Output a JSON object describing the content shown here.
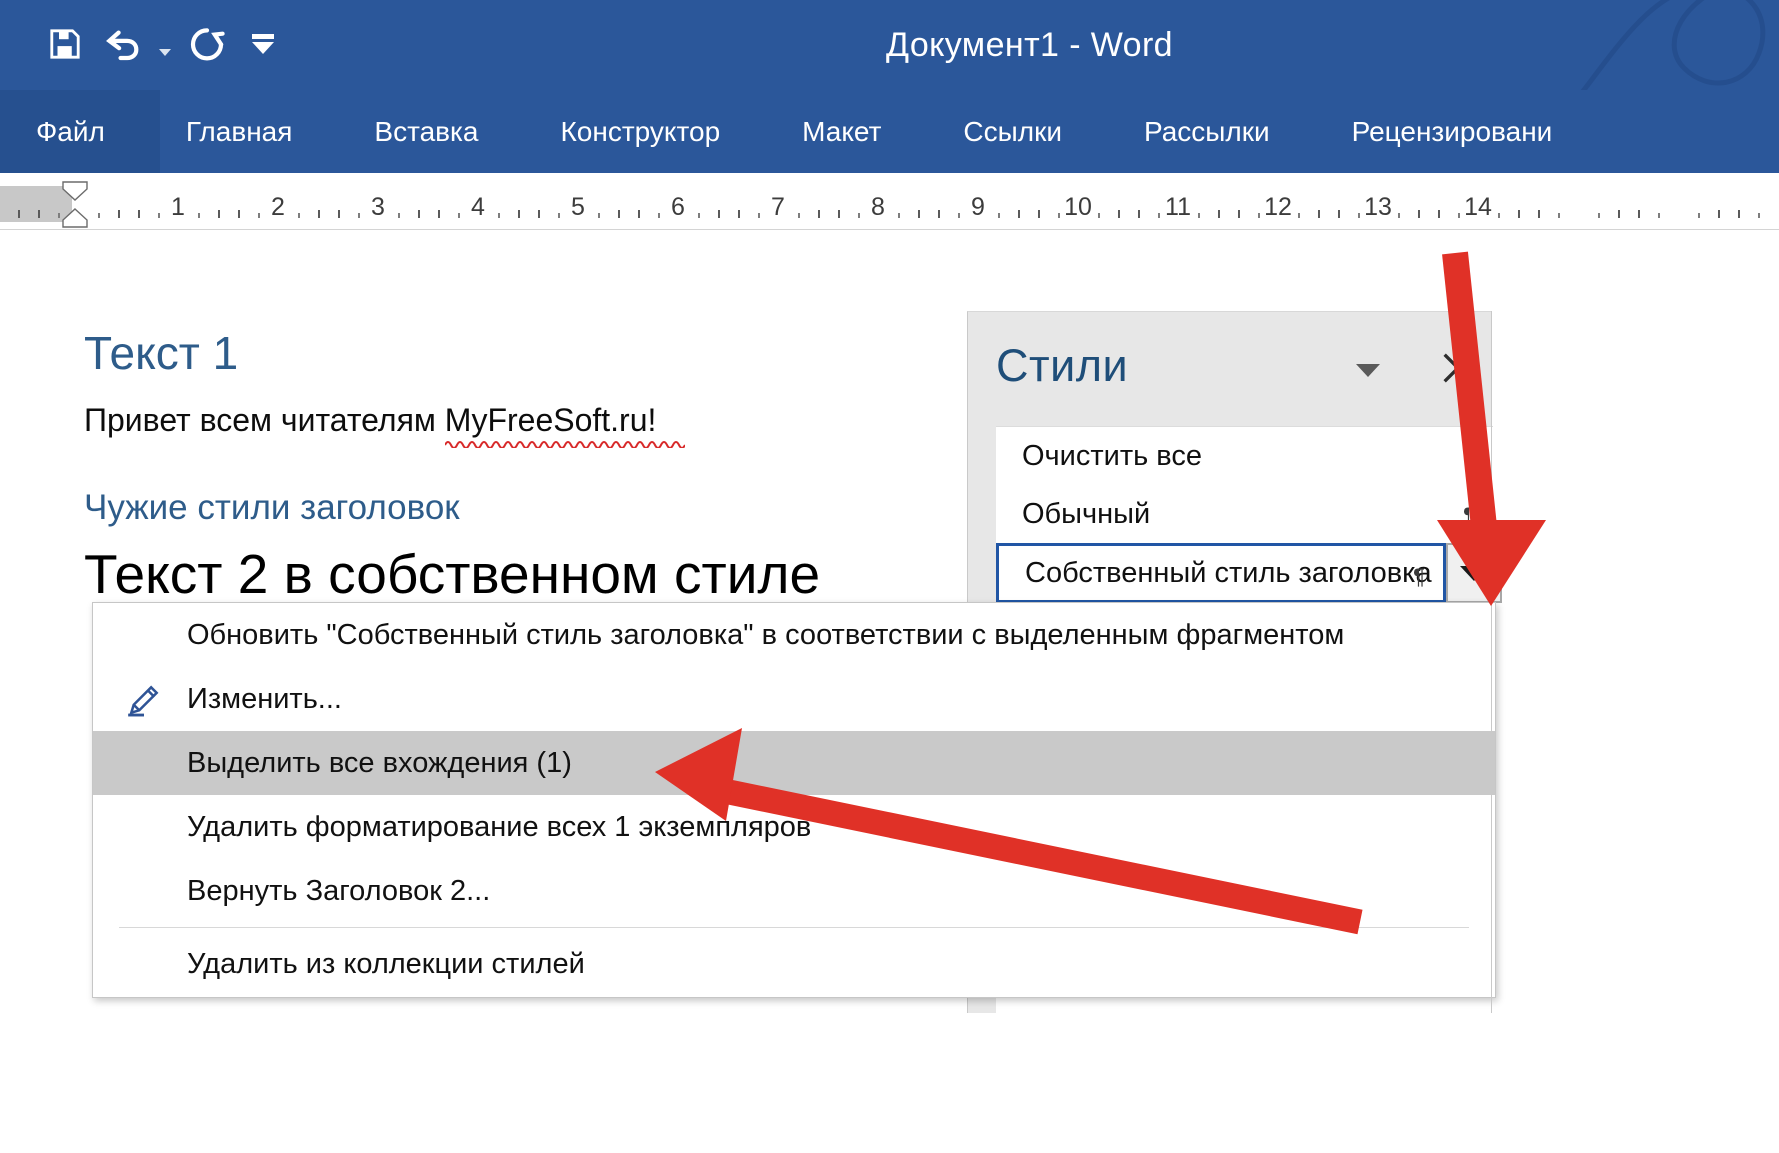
{
  "window": {
    "title": "Документ1  -  Word",
    "accent_color": "#2b579a",
    "file_tab_color": "#26508f"
  },
  "quick_access": {
    "items": [
      {
        "name": "save-icon",
        "label": "Сохранить"
      },
      {
        "name": "undo-icon",
        "label": "Отменить"
      },
      {
        "name": "undo-dropdown-caret-icon",
        "label": "Отменить (список)"
      },
      {
        "name": "redo-icon",
        "label": "Вернуть"
      },
      {
        "name": "customize-quick-access-icon",
        "label": "Настройка панели быстрого доступа"
      }
    ]
  },
  "ribbon": {
    "tabs": [
      {
        "label": "Файл",
        "active": false
      },
      {
        "label": "Главная",
        "active": false
      },
      {
        "label": "Вставка",
        "active": false
      },
      {
        "label": "Конструктор",
        "active": false
      },
      {
        "label": "Макет",
        "active": false
      },
      {
        "label": "Ссылки",
        "active": false
      },
      {
        "label": "Рассылки",
        "active": false
      },
      {
        "label": "Рецензировани",
        "active": false
      }
    ]
  },
  "ruler": {
    "numbers": [
      1,
      2,
      3,
      4,
      5,
      6,
      7,
      8,
      9,
      10,
      11,
      12,
      13,
      14
    ],
    "unit": "см"
  },
  "document": {
    "heading_1": "Текст 1",
    "paragraph_1_plain": "Привет всем читателям ",
    "paragraph_1_misspelled": "MyFreeSoft.ru",
    "paragraph_1_tail": "!",
    "heading_2": "Чужие стили заголовок",
    "heading_3": "Текст 2 в собственном стиле",
    "heading_color": "#2e5c8a"
  },
  "styles_pane": {
    "title": "Стили",
    "collapse_caret": "caret-down",
    "close_label": "×",
    "items": [
      {
        "label": "Очистить все",
        "pilcrow": false,
        "selected": false
      },
      {
        "label": "Обычный",
        "pilcrow": true,
        "selected": false
      },
      {
        "label": "Собственный стиль заголовка",
        "pilcrow": true,
        "selected": true
      }
    ],
    "selected_border_color": "#2156a5",
    "dropdown_button_label": "▼"
  },
  "context_menu": {
    "items": [
      {
        "label": "Обновить \"Собственный стиль заголовка\" в соответствии с выделенным фрагментом",
        "accel": "б",
        "icon": null,
        "highlight": false
      },
      {
        "label": "Изменить...",
        "accel": "И",
        "icon": "modify-style-icon",
        "highlight": false
      },
      {
        "label": "Выделить все вхождения (1)",
        "accel": "В",
        "icon": null,
        "highlight": true
      },
      {
        "label": "Удалить форматирование всех 1 экземпляров",
        "accel": "У",
        "icon": null,
        "highlight": false
      },
      {
        "label": "Вернуть Заголовок 2...",
        "accel": "В",
        "icon": null,
        "highlight": false
      },
      {
        "label": "Удалить из коллекции стилей",
        "accel": "с",
        "icon": null,
        "highlight": false
      }
    ],
    "separator_after_index": 4,
    "highlight_color": "#c9c9c9"
  },
  "annotations": {
    "arrow_color": "#e03127",
    "arrows": [
      {
        "name": "arrow-to-style-dropdown",
        "target": "style-dropdown-button"
      },
      {
        "name": "arrow-to-select-all-instances",
        "target": "context-menu-item-select-all"
      }
    ]
  }
}
